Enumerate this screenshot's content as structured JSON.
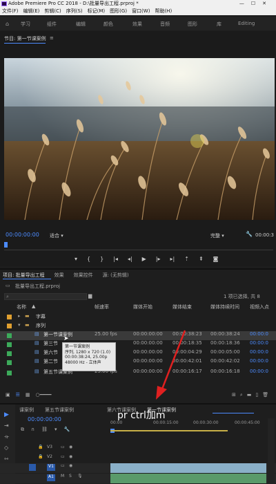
{
  "window": {
    "title": "Adobe Premiere Pro CC 2018 - D:\\批量导出工程.prproj *",
    "controls": [
      "—",
      "☐",
      "✕"
    ]
  },
  "menu": [
    "文件(F)",
    "编辑(E)",
    "剪辑(C)",
    "序列(S)",
    "标记(M)",
    "图形(G)",
    "窗口(W)",
    "帮助(H)"
  ],
  "workspaces": [
    "学习",
    "组件",
    "编辑",
    "颜色",
    "效果",
    "音频",
    "图形",
    "库",
    "Editing"
  ],
  "program_monitor": {
    "title": "节目: 第一节课案例",
    "timecode_left": "00:00:00:00",
    "fit": "适合",
    "quality": "完整",
    "timecode_right": "00:00:3"
  },
  "project_panel": {
    "tabs": [
      "项目: 批量导出工程",
      "效果",
      "效果控件",
      "源: (无剪辑)"
    ],
    "filename": "批量导出工程.prproj",
    "selection_info": "1 项已选择, 共 8",
    "columns": [
      "名称",
      "帧速率",
      "媒体开始",
      "媒体结束",
      "媒体持续时间",
      "视频入点"
    ],
    "items": [
      {
        "name": "字幕",
        "color": "#e0a030",
        "type": "bin",
        "fps": "",
        "start": "",
        "end": "",
        "dur": "",
        "vin": ""
      },
      {
        "name": "序列",
        "color": "#e0a030",
        "type": "bin",
        "fps": "",
        "start": "",
        "end": "",
        "dur": "",
        "vin": ""
      },
      {
        "name": "第一节课案例",
        "color": "#3caa5a",
        "type": "seq",
        "fps": "25.00 fps",
        "start": "00:00:00:00",
        "end": "00:00:38:23",
        "dur": "00:00:38:24",
        "vin": "00:00:0"
      },
      {
        "name": "第三节",
        "color": "#3caa5a",
        "type": "seq",
        "fps": "",
        "start": "00:00:00:00",
        "end": "00:00:18:35",
        "dur": "00:00:18:36",
        "vin": "00:00:0"
      },
      {
        "name": "第六节",
        "color": "#3caa5a",
        "type": "seq",
        "fps": "",
        "start": "00:00:00:00",
        "end": "00:00:04:29",
        "dur": "00:00:05:00",
        "vin": "00:00:0"
      },
      {
        "name": "第二节",
        "color": "#3caa5a",
        "type": "seq",
        "fps": "",
        "start": "00:00:00:00",
        "end": "00:00:42:01",
        "dur": "00:00:42:02",
        "vin": "00:00:0"
      },
      {
        "name": "第五节课案例",
        "color": "#3caa5a",
        "type": "seq",
        "fps": "25.00 fps",
        "start": "00:00:00:00",
        "end": "00:00:16:17",
        "dur": "00:00:16:18",
        "vin": "00:00:0"
      }
    ],
    "tooltip": [
      "第一节课案例",
      "序列, 1280 x 720 (1.0)",
      "00:00:38:24, 25.00p",
      "48000 Hz - 立体声"
    ]
  },
  "timeline": {
    "tabs": [
      "课案例",
      "第五节课案例",
      "第六节课案例",
      "第一节课案例"
    ],
    "timecode": "00:00:00:00",
    "ruler": [
      "00:00",
      "00:00:15:00",
      "00:00:30:00",
      "00:00:45:00"
    ],
    "tracks": [
      "V3",
      "V2",
      "V1",
      "A1"
    ]
  },
  "annotation": "pr ctrl加m",
  "colors": {
    "accent": "#4d8cff",
    "label_orange": "#e0a030",
    "label_green": "#3caa5a",
    "arrow_red": "#e02020"
  }
}
